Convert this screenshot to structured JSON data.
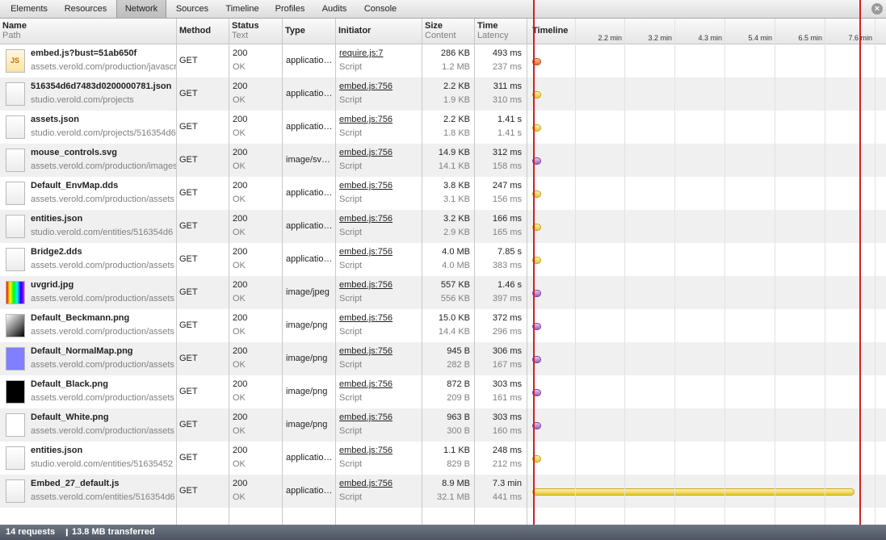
{
  "tabs": [
    {
      "label": "Elements",
      "active": false
    },
    {
      "label": "Resources",
      "active": false
    },
    {
      "label": "Network",
      "active": true
    },
    {
      "label": "Sources",
      "active": false
    },
    {
      "label": "Timeline",
      "active": false
    },
    {
      "label": "Profiles",
      "active": false
    },
    {
      "label": "Audits",
      "active": false
    },
    {
      "label": "Console",
      "active": false
    }
  ],
  "close_icon": "close-icon",
  "columns": {
    "name": {
      "title": "Name",
      "sub": "Path"
    },
    "method": {
      "title": "Method",
      "sub": ""
    },
    "status": {
      "title": "Status",
      "sub": "Text"
    },
    "type": {
      "title": "Type",
      "sub": ""
    },
    "initiator": {
      "title": "Initiator",
      "sub": ""
    },
    "size": {
      "title": "Size",
      "sub": "Content"
    },
    "time": {
      "title": "Time",
      "sub": "Latency"
    },
    "timeline": {
      "title": "Timeline",
      "sub": ""
    }
  },
  "timeline_ticks": [
    "2.2 min",
    "3.2 min",
    "4.3 min",
    "5.4 min",
    "6.5 min",
    "7.6 min"
  ],
  "requests": [
    {
      "name": "embed.js?bust=51ab650f",
      "path": "assets.verold.com/production/javascript",
      "icon": "js-file-icon",
      "method": "GET",
      "status": "200",
      "status_text": "OK",
      "type": "applicatio…",
      "initiator": "require.js:7",
      "initiator_type": "Script",
      "size": "286 KB",
      "content": "1.2 MB",
      "time": "493 ms",
      "latency": "237 ms",
      "bar_color": "orange",
      "bar_length": 0.0
    },
    {
      "name": "516354d6d7483d0200000781.json",
      "path": "studio.verold.com/projects",
      "icon": "file-icon",
      "method": "GET",
      "status": "200",
      "status_text": "OK",
      "type": "applicatio…",
      "initiator": "embed.js:756",
      "initiator_type": "Script",
      "size": "2.2 KB",
      "content": "1.9 KB",
      "time": "311 ms",
      "latency": "310 ms",
      "bar_color": "yellow",
      "bar_length": 0.0
    },
    {
      "name": "assets.json",
      "path": "studio.verold.com/projects/516354d6",
      "icon": "file-icon",
      "method": "GET",
      "status": "200",
      "status_text": "OK",
      "type": "applicatio…",
      "initiator": "embed.js:756",
      "initiator_type": "Script",
      "size": "2.2 KB",
      "content": "1.8 KB",
      "time": "1.41 s",
      "latency": "1.41 s",
      "bar_color": "yellow",
      "bar_length": 0.0
    },
    {
      "name": "mouse_controls.svg",
      "path": "assets.verold.com/production/images",
      "icon": "svg-file-icon",
      "method": "GET",
      "status": "200",
      "status_text": "OK",
      "type": "image/sv…",
      "initiator": "embed.js:756",
      "initiator_type": "Script",
      "size": "14.9 KB",
      "content": "14.1 KB",
      "time": "312 ms",
      "latency": "158 ms",
      "bar_color": "purple",
      "bar_length": 0.0
    },
    {
      "name": "Default_EnvMap.dds",
      "path": "assets.verold.com/production/assets",
      "icon": "file-icon",
      "method": "GET",
      "status": "200",
      "status_text": "OK",
      "type": "applicatio…",
      "initiator": "embed.js:756",
      "initiator_type": "Script",
      "size": "3.8 KB",
      "content": "3.1 KB",
      "time": "247 ms",
      "latency": "156 ms",
      "bar_color": "yellow",
      "bar_length": 0.0
    },
    {
      "name": "entities.json",
      "path": "studio.verold.com/entities/516354d6",
      "icon": "file-icon",
      "method": "GET",
      "status": "200",
      "status_text": "OK",
      "type": "applicatio…",
      "initiator": "embed.js:756",
      "initiator_type": "Script",
      "size": "3.2 KB",
      "content": "2.9 KB",
      "time": "166 ms",
      "latency": "165 ms",
      "bar_color": "yellow",
      "bar_length": 0.0
    },
    {
      "name": "Bridge2.dds",
      "path": "assets.verold.com/production/assets",
      "icon": "file-icon",
      "method": "GET",
      "status": "200",
      "status_text": "OK",
      "type": "applicatio…",
      "initiator": "embed.js:756",
      "initiator_type": "Script",
      "size": "4.0 MB",
      "content": "4.0 MB",
      "time": "7.85 s",
      "latency": "383 ms",
      "bar_color": "yellow",
      "bar_length": 0.018
    },
    {
      "name": "uvgrid.jpg",
      "path": "assets.verold.com/production/assets",
      "icon": "uvgrid-thumbnail",
      "method": "GET",
      "status": "200",
      "status_text": "OK",
      "type": "image/jpeg",
      "initiator": "embed.js:756",
      "initiator_type": "Script",
      "size": "557 KB",
      "content": "556 KB",
      "time": "1.46 s",
      "latency": "397 ms",
      "bar_color": "purple",
      "bar_length": 0.0
    },
    {
      "name": "Default_Beckmann.png",
      "path": "assets.verold.com/production/assets",
      "icon": "beckmann-thumbnail",
      "method": "GET",
      "status": "200",
      "status_text": "OK",
      "type": "image/png",
      "initiator": "embed.js:756",
      "initiator_type": "Script",
      "size": "15.0 KB",
      "content": "14.4 KB",
      "time": "372 ms",
      "latency": "296 ms",
      "bar_color": "purple",
      "bar_length": 0.0
    },
    {
      "name": "Default_NormalMap.png",
      "path": "assets.verold.com/production/assets",
      "icon": "normalmap-thumbnail",
      "method": "GET",
      "status": "200",
      "status_text": "OK",
      "type": "image/png",
      "initiator": "embed.js:756",
      "initiator_type": "Script",
      "size": "945 B",
      "content": "282 B",
      "time": "306 ms",
      "latency": "167 ms",
      "bar_color": "purple",
      "bar_length": 0.0
    },
    {
      "name": "Default_Black.png",
      "path": "assets.verold.com/production/assets",
      "icon": "black-thumbnail",
      "method": "GET",
      "status": "200",
      "status_text": "OK",
      "type": "image/png",
      "initiator": "embed.js:756",
      "initiator_type": "Script",
      "size": "872 B",
      "content": "209 B",
      "time": "303 ms",
      "latency": "161 ms",
      "bar_color": "purple",
      "bar_length": 0.0
    },
    {
      "name": "Default_White.png",
      "path": "assets.verold.com/production/assets",
      "icon": "white-thumbnail",
      "method": "GET",
      "status": "200",
      "status_text": "OK",
      "type": "image/png",
      "initiator": "embed.js:756",
      "initiator_type": "Script",
      "size": "963 B",
      "content": "300 B",
      "time": "303 ms",
      "latency": "160 ms",
      "bar_color": "purple",
      "bar_length": 0.0
    },
    {
      "name": "entities.json",
      "path": "studio.verold.com/entities/51635452",
      "icon": "file-icon",
      "method": "GET",
      "status": "200",
      "status_text": "OK",
      "type": "applicatio…",
      "initiator": "embed.js:756",
      "initiator_type": "Script",
      "size": "1.1 KB",
      "content": "829 B",
      "time": "248 ms",
      "latency": "212 ms",
      "bar_color": "yellow",
      "bar_length": 0.0
    },
    {
      "name": "Embed_27_default.js",
      "path": "assets.verold.com/entities/516354d6",
      "icon": "file-icon",
      "method": "GET",
      "status": "200",
      "status_text": "OK",
      "type": "applicatio…",
      "initiator": "embed.js:756",
      "initiator_type": "Script",
      "size": "8.9 MB",
      "content": "32.1 MB",
      "time": "7.3 min",
      "latency": "441 ms",
      "bar_color": "yellow",
      "bar_length": 1.0
    }
  ],
  "status_bar": {
    "requests": "14 requests",
    "separator": "❙",
    "transferred": "13.8 MB transferred"
  },
  "colors": {
    "marker_red": "#d42020",
    "bar_yellow": "#f2dc5d",
    "bar_orange": "#e76a2e",
    "bar_purple": "#a56bcd",
    "status_bar_bg": "#5a636f"
  }
}
